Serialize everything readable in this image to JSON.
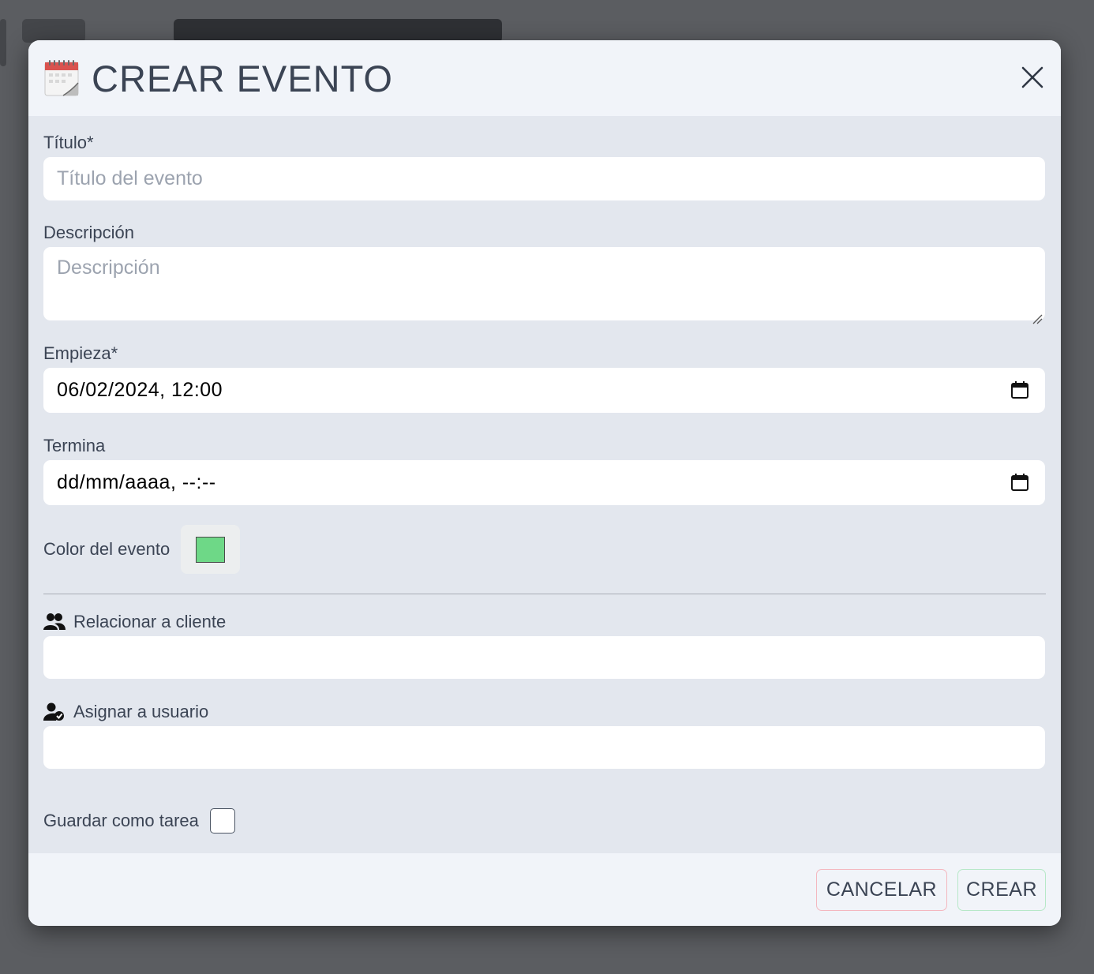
{
  "modal": {
    "title": "CREAR EVENTO",
    "icon": "calendar-icon",
    "close_icon": "close-icon"
  },
  "fields": {
    "titulo": {
      "label": "Título*",
      "placeholder": "Título del evento",
      "value": ""
    },
    "descripcion": {
      "label": "Descripción",
      "placeholder": "Descripción",
      "value": ""
    },
    "empieza": {
      "label": "Empieza*",
      "value": "06/02/2024, 12:00",
      "icon": "calendar-icon"
    },
    "termina": {
      "label": "Termina",
      "value": "dd/mm/aaaa, --:--",
      "icon": "calendar-icon"
    },
    "color": {
      "label": "Color del evento",
      "value": "#6ed887"
    },
    "cliente": {
      "label": "Relacionar a cliente",
      "icon": "users-icon",
      "value": ""
    },
    "usuario": {
      "label": "Asignar a usuario",
      "icon": "user-check-icon",
      "value": ""
    },
    "tarea": {
      "label": "Guardar como tarea",
      "checked": false
    }
  },
  "footer": {
    "cancel_label": "CANCELAR",
    "create_label": "CREAR"
  },
  "colors": {
    "overlay": "#5b5d61",
    "modal_body": "#e3e7ee",
    "modal_header": "#f1f4f9",
    "text": "#3b4454",
    "cancel_border": "#f4b7bf",
    "create_border": "#b7e8c8"
  }
}
